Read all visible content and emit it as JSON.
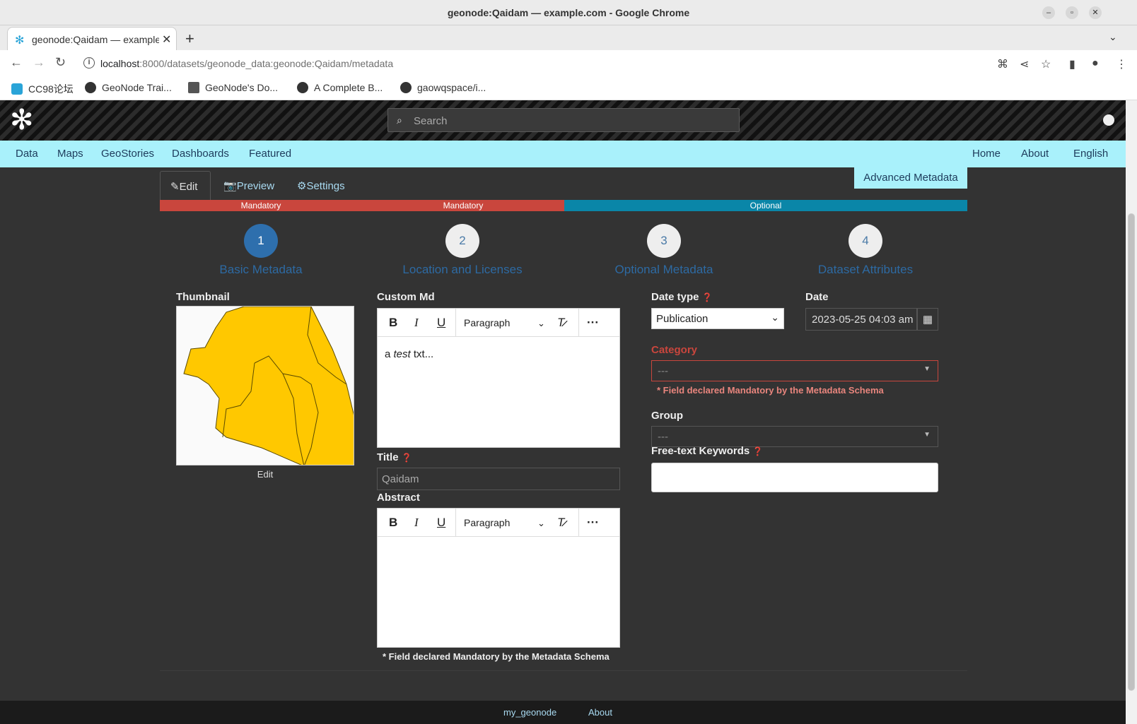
{
  "window": {
    "title": "geonode:Qaidam — example.com - Google Chrome"
  },
  "browser": {
    "tab_title": "geonode:Qaidam — example.com",
    "url_host": "localhost",
    "url_rest": ":8000/datasets/geonode_data:geonode:Qaidam/metadata",
    "bookmarks": [
      "CC98论坛",
      "GeoNode Trai...",
      "GeoNode's Do...",
      "A Complete B...",
      "gaowqspace/i..."
    ]
  },
  "header": {
    "search_placeholder": "Search"
  },
  "menu": {
    "left": [
      "Data",
      "Maps",
      "GeoStories",
      "Dashboards",
      "Featured"
    ],
    "right": [
      "Home",
      "About",
      "English"
    ]
  },
  "tabs": {
    "edit": "Edit",
    "preview": "Preview",
    "settings": "Settings"
  },
  "advanced_button": "Advanced Metadata",
  "progress": {
    "seg1": "Mandatory",
    "seg2": "Mandatory",
    "seg3": "Optional",
    "colors": {
      "mandatory": "#c9463d",
      "optional": "#0a86a8"
    }
  },
  "steps": [
    {
      "num": "1",
      "label": "Basic Metadata"
    },
    {
      "num": "2",
      "label": "Location and Licenses"
    },
    {
      "num": "3",
      "label": "Optional Metadata"
    },
    {
      "num": "4",
      "label": "Dataset Attributes"
    }
  ],
  "form": {
    "thumbnail_label": "Thumbnail",
    "thumbnail_edit": "Edit",
    "custom_md_label": "Custom Md",
    "custom_md_text_a": "a ",
    "custom_md_text_em": "test",
    "custom_md_text_b": " txt...",
    "editor_paragraph": "Paragraph",
    "title_label": "Title",
    "title_value": "Qaidam",
    "abstract_label": "Abstract",
    "abstract_note": "* Field declared Mandatory by the Metadata Schema",
    "date_type_label": "Date type",
    "date_type_value": "Publication",
    "date_label": "Date",
    "date_value": "2023-05-25 04:03 am",
    "category_label": "Category",
    "category_value": "---",
    "category_note": "* Field declared Mandatory by the Metadata Schema",
    "group_label": "Group",
    "group_value": "---",
    "keywords_label": "Free-text Keywords"
  },
  "footer": {
    "link1": "my_geonode",
    "link2": "About"
  }
}
